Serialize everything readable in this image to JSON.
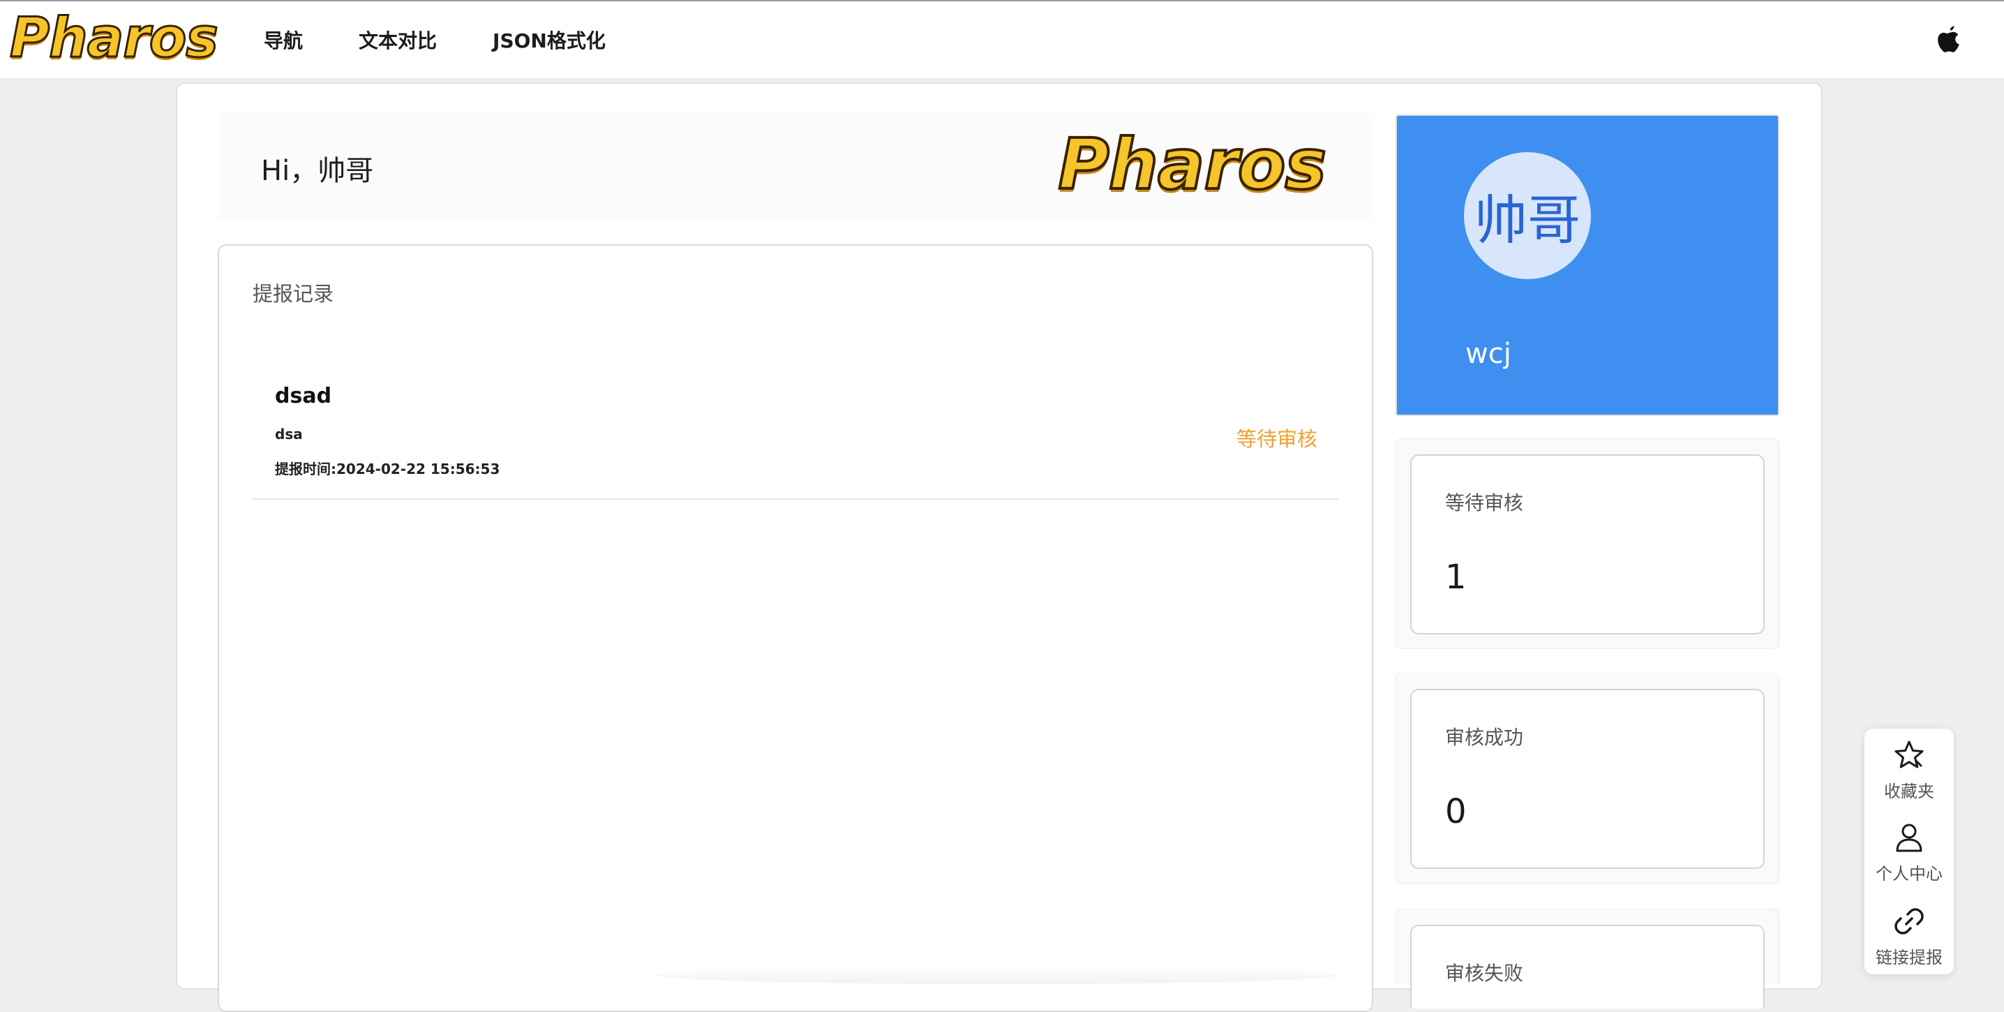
{
  "nav": {
    "brand": "Pharos",
    "links": [
      "导航",
      "文本对比",
      "JSON格式化"
    ],
    "right_icon": "apple-icon"
  },
  "greeting": {
    "text": "Hi，帅哥",
    "logo": "Pharos"
  },
  "records": {
    "title": "提报记录",
    "items": [
      {
        "title": "dsad",
        "desc": "dsa",
        "time": "提报时间:2024-02-22 15:56:53",
        "status": "等待审核"
      }
    ]
  },
  "profile": {
    "avatar_text": "帅哥",
    "username": "wcj",
    "card_color": "#3f8ff0"
  },
  "stats": [
    {
      "label": "等待审核",
      "value": "1"
    },
    {
      "label": "审核成功",
      "value": "0"
    },
    {
      "label": "审核失败",
      "value": ""
    }
  ],
  "float_menu": [
    {
      "label": "收藏夹",
      "icon": "star-icon"
    },
    {
      "label": "个人中心",
      "icon": "person-icon"
    },
    {
      "label": "链接提报",
      "icon": "link-icon"
    }
  ],
  "colors": {
    "accent": "#3f8ff0",
    "status_pending": "#f0a030"
  }
}
